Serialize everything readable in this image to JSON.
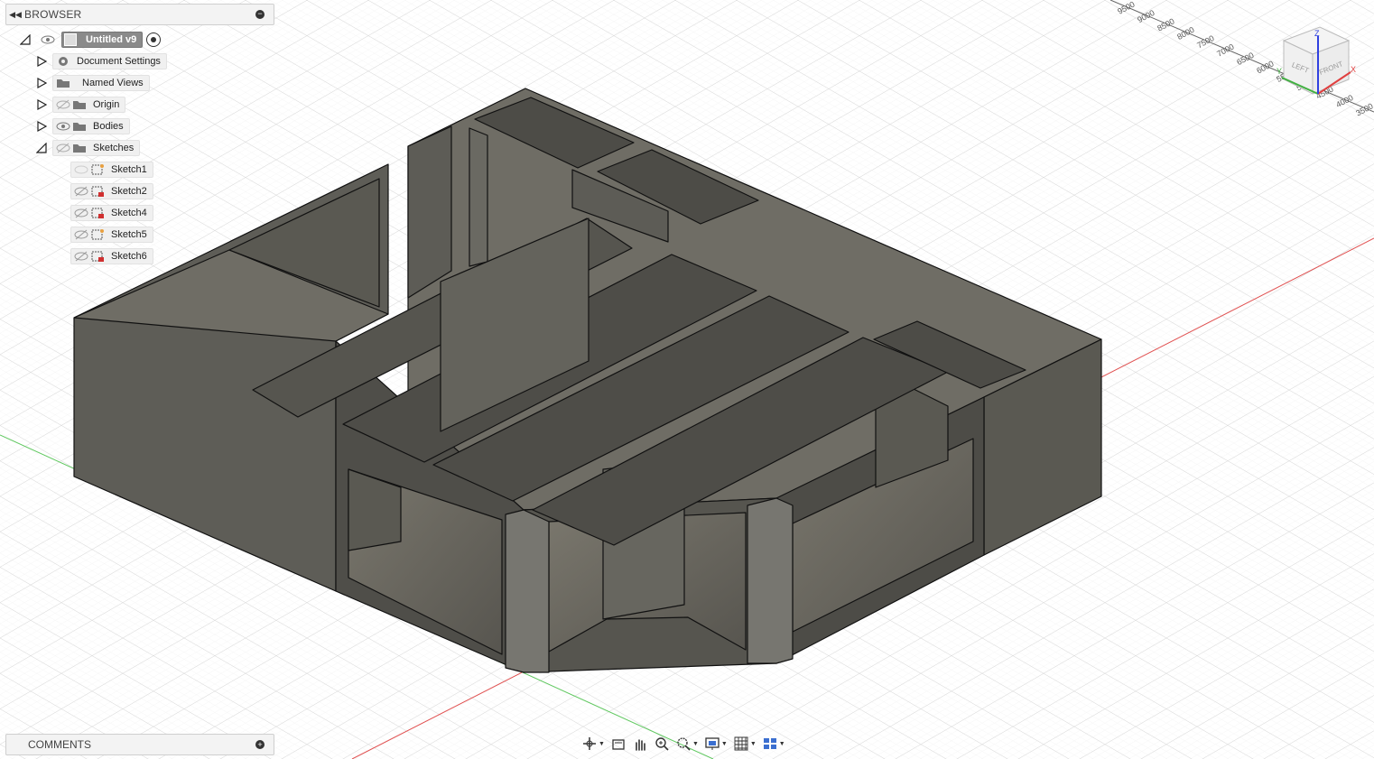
{
  "browser": {
    "title": "BROWSER",
    "root": {
      "label": "Untitled v9"
    },
    "items": [
      {
        "label": "Document Settings",
        "icon": "gear-icon"
      },
      {
        "label": "Named Views",
        "icon": "folder-icon"
      },
      {
        "label": "Origin",
        "icon": "folder-icon",
        "visible": false
      },
      {
        "label": "Bodies",
        "icon": "folder-icon",
        "visible": true
      },
      {
        "label": "Sketches",
        "icon": "folder-icon",
        "visible": false,
        "expanded": true
      }
    ],
    "sketches": [
      {
        "label": "Sketch1"
      },
      {
        "label": "Sketch2"
      },
      {
        "label": "Sketch4"
      },
      {
        "label": "Sketch5"
      },
      {
        "label": "Sketch6"
      }
    ]
  },
  "comments": {
    "title": "COMMENTS"
  },
  "viewcube": {
    "faces": [
      "FRONT",
      "LEFT",
      "TOP"
    ]
  },
  "ruler": {
    "ticks": [
      "9500",
      "9000",
      "8500",
      "8000",
      "7500",
      "7000",
      "6500",
      "6000",
      "5500",
      "5000",
      "4500",
      "4000",
      "3500"
    ]
  },
  "toolbar": {
    "icons": [
      "orbit-icon",
      "look-at-icon",
      "pan-icon",
      "zoom-icon",
      "fit-icon",
      "display-settings-icon",
      "grid-icon",
      "viewports-icon"
    ]
  },
  "colors": {
    "model_top": "#6e6c64",
    "model_side": "#5f5e58",
    "model_dark": "#4b4a45",
    "axis_x": "#e05050",
    "axis_y": "#50c050"
  }
}
